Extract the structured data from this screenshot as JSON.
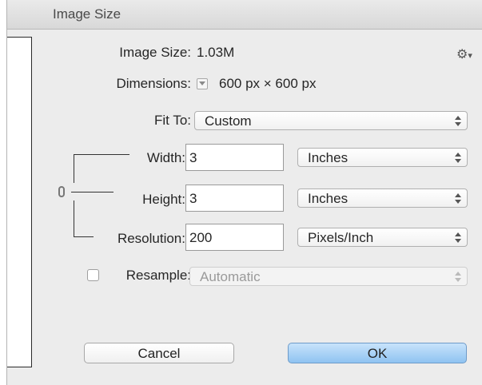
{
  "window": {
    "title": "Image Size"
  },
  "image_size": {
    "label": "Image Size:",
    "value": "1.03M"
  },
  "gear": {
    "icon": "gear-icon",
    "glyph": "⚙"
  },
  "dimensions": {
    "label": "Dimensions:",
    "value": "600 px  ×  600 px"
  },
  "fit_to": {
    "label": "Fit To:",
    "selected": "Custom"
  },
  "width": {
    "label": "Width:",
    "value": "3",
    "unit": "Inches"
  },
  "height": {
    "label": "Height:",
    "value": "3",
    "unit": "Inches"
  },
  "resolution": {
    "label": "Resolution:",
    "value": "200",
    "unit": "Pixels/Inch"
  },
  "resample": {
    "label": "Resample:",
    "checked": false,
    "method": "Automatic"
  },
  "buttons": {
    "cancel": "Cancel",
    "ok": "OK"
  }
}
